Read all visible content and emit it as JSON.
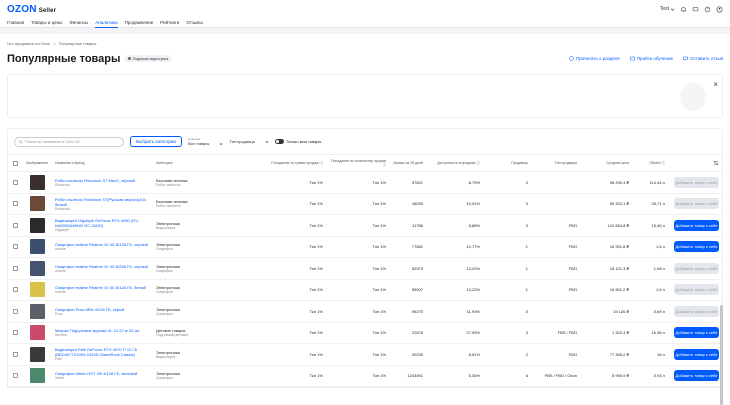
{
  "header": {
    "logo_brand": "OZON",
    "logo_sub": "Seller",
    "user": "Test",
    "accent": "#005bff"
  },
  "nav": {
    "items": [
      {
        "label": "Главная"
      },
      {
        "label": "Товары и цены"
      },
      {
        "label": "Финансы"
      },
      {
        "label": "Аналитика",
        "active": true
      },
      {
        "label": "Продвижение"
      },
      {
        "label": "Рейтинги"
      },
      {
        "label": "Отзывы"
      }
    ]
  },
  "breadcrumb": {
    "parent": "Что продавать на Ozon",
    "separator": ">",
    "current": "Популярные товары"
  },
  "page": {
    "title": "Популярные товары",
    "badge": "Подписка недоступна",
    "links": {
      "about": "Прочитать о разделе",
      "training": "Пройти обучение",
      "feedback": "Оставить отзыв"
    }
  },
  "filters": {
    "search_placeholder": "Поиск по названию и Ozon ID",
    "category_button": "Выбрать категории",
    "novelty_label": "Новинка",
    "novelty_value": "Все товары",
    "seller_type_value": "Тип продавца",
    "toggle_label": "Только мои товары"
  },
  "table": {
    "headers": {
      "image": "Изображение",
      "name": "Название и бренд",
      "category": "Категория",
      "share_sum": "Попадание по сумме продаж ⓘ",
      "share_qty": "Попадание по количеству продаж ⓘ",
      "sold": "Заказы за 28 дней",
      "availability": "Доступность в продаже ⓘ",
      "promo": "Продавцы",
      "scheme": "Тип продавца",
      "price": "Средняя цена",
      "volume": "Объём ⓘ"
    },
    "rows": [
      {
        "name": "Робот-пылесос Roborock S7 MaxV_черный",
        "brand": "Roborock",
        "cat": "Бытовая техника",
        "subcat": "Робот-пылесос",
        "s1": "Топ 1%",
        "s2": "Топ 1%",
        "sold": "37821",
        "avail": "8,79%",
        "prom": "0",
        "sch": "",
        "price": "96 290,3 ₽",
        "vol": "114,44 л",
        "action": "Добавить товар к себе",
        "enabled": false,
        "thumb": "#3a2f2a"
      },
      {
        "name": "Робот-пылесос Roborock S7(Русская версия),EA: белый",
        "brand": "Roborock",
        "cat": "Бытовая техника",
        "subcat": "Робот-пылесос",
        "s1": "Топ 1%",
        "s2": "Топ 1%",
        "sold": "18030",
        "avail": "10,01%",
        "prom": "0",
        "sch": "",
        "price": "59 323,1 ₽",
        "vol": "28,71 л",
        "action": "Добавить товар к себе",
        "enabled": false,
        "thumb": "#6b4a3a"
      },
      {
        "name": "Видеокарта Gigabyte GeForce RTX 4090 (GV-N4090GAMING OC-24GD)",
        "brand": "Gigabyte",
        "cat": "Электроника",
        "subcat": "Видеокарта",
        "s1": "Топ 1%",
        "s2": "Топ 1%",
        "sold": "11786",
        "avail": "8,88%",
        "prom": "3",
        "sch": "FBO",
        "price": "124 554,8 ₽",
        "vol": "15,46 л",
        "action": "Добавить товар к себе",
        "enabled": true,
        "thumb": "#2b2b2b"
      },
      {
        "name": "Смартфон realme Realme 10 4G 8/128 ГБ, черный",
        "brand": "realme",
        "cat": "Электроника",
        "subcat": "Смартфон",
        "s1": "Топ 1%",
        "s2": "Топ 1%",
        "sold": "77682",
        "avail": "10,77%",
        "prom": "1",
        "sch": "FBO",
        "price": "16 901,8 ₽",
        "vol": "1,6 л",
        "action": "Добавить товар к себе",
        "enabled": true,
        "thumb": "#3d4f6e"
      },
      {
        "name": "Смартфон realme Realme 10 4G 8/256 ГБ, черный",
        "brand": "realme",
        "cat": "Электроника",
        "subcat": "Смартфон",
        "s1": "Топ 1%",
        "s2": "Топ 1%",
        "sold": "52973",
        "avail": "13,20%",
        "prom": "1",
        "sch": "FBO",
        "price": "18 121,3 ₽",
        "vol": "1,08 л",
        "action": "Добавить товар к себе",
        "enabled": false,
        "thumb": "#44546f"
      },
      {
        "name": "Смартфон realme Realme 10 4G 8/128 ГБ, белый",
        "brand": "realme",
        "cat": "Электроника",
        "subcat": "Смартфон",
        "s1": "Топ 1%",
        "s2": "Топ 1%",
        "sold": "55007",
        "avail": "13,22%",
        "prom": "1",
        "sch": "FBO",
        "price": "16 901,2 ₽",
        "vol": "1,6 л",
        "action": "Добавить товар к себе",
        "enabled": false,
        "thumb": "#d8c24a"
      },
      {
        "name": "Смартфон Poco M5s 4/128 ГБ, серый",
        "brand": "Poco",
        "cat": "Электроника",
        "subcat": "Смартфон",
        "s1": "Топ 1%",
        "s2": "Топ 1%",
        "sold": "95270",
        "avail": "11,93%",
        "prom": "0",
        "sch": "",
        "price": "19 126 ₽",
        "vol": "0,69 л",
        "action": "Добавить товар к себе",
        "enabled": false,
        "thumb": "#5d6068"
      },
      {
        "name": "Матрас Подгузники-трусики XL 12-22 кг 52 шт",
        "brand": "Merries",
        "cat": "Детские товары",
        "subcat": "Подгузники детские",
        "s1": "Топ 1%",
        "s2": "Топ 1%",
        "sold": "22676",
        "avail": "27,93%",
        "prom": "3",
        "sch": "FBS / FBO",
        "price": "1 322,4 ₽",
        "vol": "16,36 л",
        "action": "Добавить товар к себе",
        "enabled": true,
        "thumb": "#c94a6a"
      },
      {
        "name": "Видеокарта Palit GeForce RTX 4070 Ti 12 ГБ (NED407T019K9-1043D GameRock Classic)",
        "brand": "Palit",
        "cat": "Электроника",
        "subcat": "Видеокарта",
        "s1": "Топ 1%",
        "s2": "Топ 1%",
        "sold": "20239",
        "avail": "8,61%",
        "prom": "2",
        "sch": "FBO",
        "price": "77 345,2 ₽",
        "vol": "16 л",
        "action": "Добавить товар к себе",
        "enabled": true,
        "thumb": "#3a3a3a"
      },
      {
        "name": "Смартфон Infinix HOT 20i 4/128 ГБ, зеленый",
        "brand": "Infinix",
        "cat": "Электроника",
        "subcat": "Смартфон",
        "s1": "Топ 1%",
        "s2": "Топ 1%",
        "sold": "1243491",
        "avail": "5,36%",
        "prom": "6",
        "sch": "FBS / FBO / Ozon",
        "price": "8 990,9 ₽",
        "vol": "0,93 л",
        "action": "Добавить товар к себе",
        "enabled": true,
        "thumb": "#4a8a6a"
      }
    ]
  }
}
